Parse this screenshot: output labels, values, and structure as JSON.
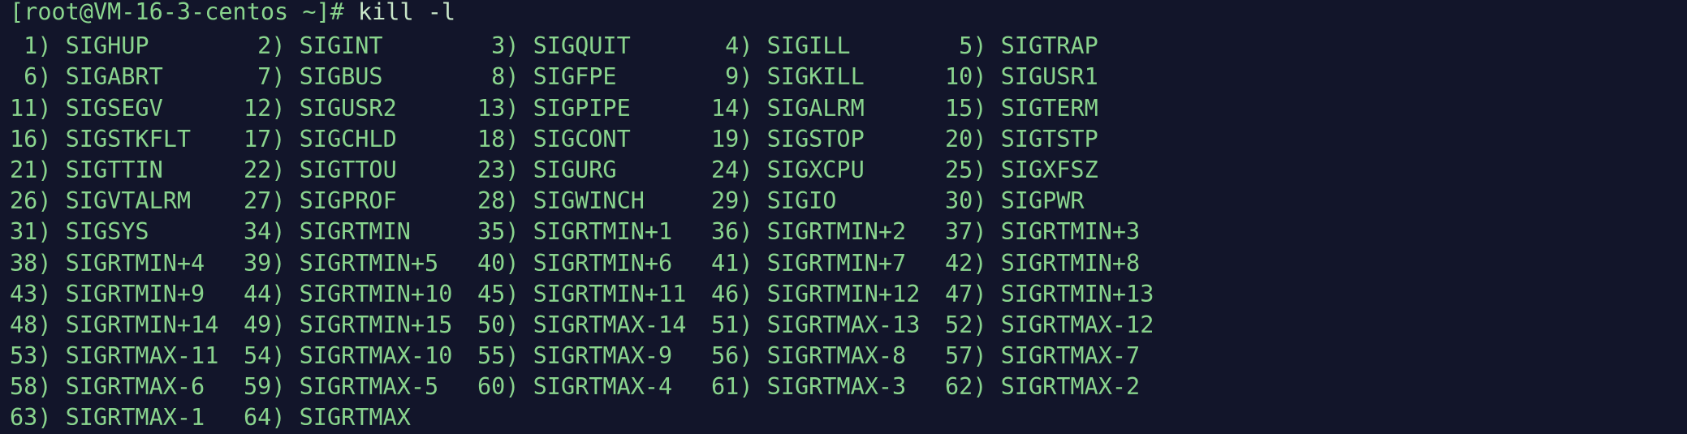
{
  "terminal": {
    "prompt": "[root@VM-16-3-centos ~]# ",
    "command": "kill -l",
    "signals": [
      {
        "num": "1",
        "name": "SIGHUP"
      },
      {
        "num": "2",
        "name": "SIGINT"
      },
      {
        "num": "3",
        "name": "SIGQUIT"
      },
      {
        "num": "4",
        "name": "SIGILL"
      },
      {
        "num": "5",
        "name": "SIGTRAP"
      },
      {
        "num": "6",
        "name": "SIGABRT"
      },
      {
        "num": "7",
        "name": "SIGBUS"
      },
      {
        "num": "8",
        "name": "SIGFPE"
      },
      {
        "num": "9",
        "name": "SIGKILL"
      },
      {
        "num": "10",
        "name": "SIGUSR1"
      },
      {
        "num": "11",
        "name": "SIGSEGV"
      },
      {
        "num": "12",
        "name": "SIGUSR2"
      },
      {
        "num": "13",
        "name": "SIGPIPE"
      },
      {
        "num": "14",
        "name": "SIGALRM"
      },
      {
        "num": "15",
        "name": "SIGTERM"
      },
      {
        "num": "16",
        "name": "SIGSTKFLT"
      },
      {
        "num": "17",
        "name": "SIGCHLD"
      },
      {
        "num": "18",
        "name": "SIGCONT"
      },
      {
        "num": "19",
        "name": "SIGSTOP"
      },
      {
        "num": "20",
        "name": "SIGTSTP"
      },
      {
        "num": "21",
        "name": "SIGTTIN"
      },
      {
        "num": "22",
        "name": "SIGTTOU"
      },
      {
        "num": "23",
        "name": "SIGURG"
      },
      {
        "num": "24",
        "name": "SIGXCPU"
      },
      {
        "num": "25",
        "name": "SIGXFSZ"
      },
      {
        "num": "26",
        "name": "SIGVTALRM"
      },
      {
        "num": "27",
        "name": "SIGPROF"
      },
      {
        "num": "28",
        "name": "SIGWINCH"
      },
      {
        "num": "29",
        "name": "SIGIO"
      },
      {
        "num": "30",
        "name": "SIGPWR"
      },
      {
        "num": "31",
        "name": "SIGSYS"
      },
      {
        "num": "34",
        "name": "SIGRTMIN"
      },
      {
        "num": "35",
        "name": "SIGRTMIN+1"
      },
      {
        "num": "36",
        "name": "SIGRTMIN+2"
      },
      {
        "num": "37",
        "name": "SIGRTMIN+3"
      },
      {
        "num": "38",
        "name": "SIGRTMIN+4"
      },
      {
        "num": "39",
        "name": "SIGRTMIN+5"
      },
      {
        "num": "40",
        "name": "SIGRTMIN+6"
      },
      {
        "num": "41",
        "name": "SIGRTMIN+7"
      },
      {
        "num": "42",
        "name": "SIGRTMIN+8"
      },
      {
        "num": "43",
        "name": "SIGRTMIN+9"
      },
      {
        "num": "44",
        "name": "SIGRTMIN+10"
      },
      {
        "num": "45",
        "name": "SIGRTMIN+11"
      },
      {
        "num": "46",
        "name": "SIGRTMIN+12"
      },
      {
        "num": "47",
        "name": "SIGRTMIN+13"
      },
      {
        "num": "48",
        "name": "SIGRTMIN+14"
      },
      {
        "num": "49",
        "name": "SIGRTMIN+15"
      },
      {
        "num": "50",
        "name": "SIGRTMAX-14"
      },
      {
        "num": "51",
        "name": "SIGRTMAX-13"
      },
      {
        "num": "52",
        "name": "SIGRTMAX-12"
      },
      {
        "num": "53",
        "name": "SIGRTMAX-11"
      },
      {
        "num": "54",
        "name": "SIGRTMAX-10"
      },
      {
        "num": "55",
        "name": "SIGRTMAX-9"
      },
      {
        "num": "56",
        "name": "SIGRTMAX-8"
      },
      {
        "num": "57",
        "name": "SIGRTMAX-7"
      },
      {
        "num": "58",
        "name": "SIGRTMAX-6"
      },
      {
        "num": "59",
        "name": "SIGRTMAX-5"
      },
      {
        "num": "60",
        "name": "SIGRTMAX-4"
      },
      {
        "num": "61",
        "name": "SIGRTMAX-3"
      },
      {
        "num": "62",
        "name": "SIGRTMAX-2"
      },
      {
        "num": "63",
        "name": "SIGRTMAX-1"
      },
      {
        "num": "64",
        "name": "SIGRTMAX"
      }
    ]
  },
  "colors": {
    "background": "#12152a",
    "text": "#89d48d",
    "command": "#c9e7c9"
  }
}
